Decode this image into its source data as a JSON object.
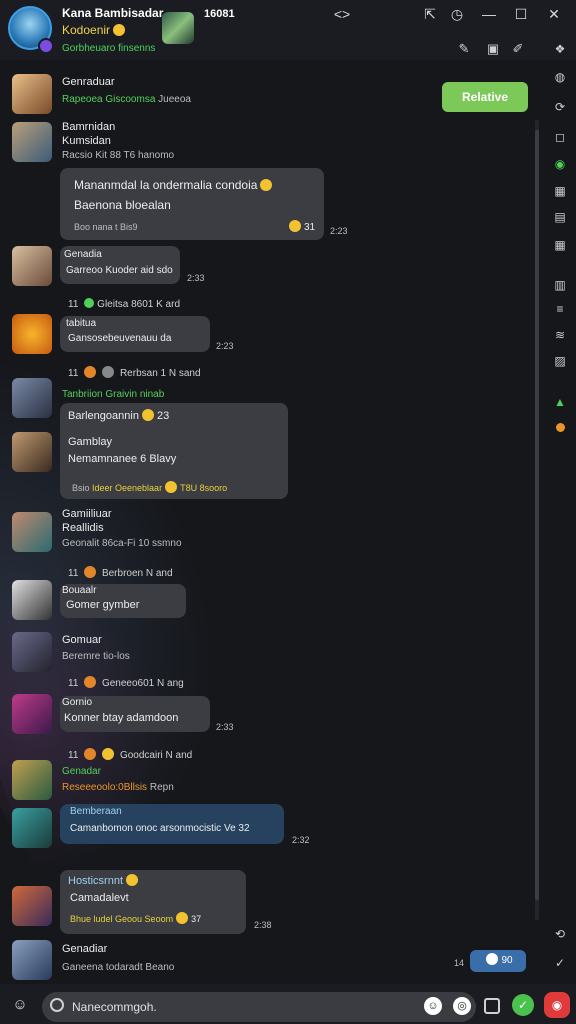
{
  "header": {
    "title": "Kana Bambisadar",
    "status": "Kodoenir",
    "subtitle": "Gorbheuaro finsenns",
    "counter": "16081"
  },
  "colors": {
    "accent_green": "#7cc95a",
    "name_green": "#4cd15a",
    "name_orange": "#e8962a",
    "name_yellow": "#e8d23a",
    "bubble": "#3b3d43",
    "bubble_highlight": "#27425e"
  },
  "icons": {
    "window": [
      "code-icon",
      "pin-icon",
      "minimize-icon",
      "maximize-icon",
      "close-icon"
    ],
    "toolbar": [
      "pen-icon",
      "copy-icon",
      "edit-icon"
    ],
    "rail": [
      "gift-icon",
      "wifi-icon",
      "check-circle-icon",
      "sticker-icon",
      "image-icon",
      "image-icon",
      "chart-icon",
      "list-icon",
      "voice-icon",
      "photo-icon",
      "upload-icon",
      "status-dot-icon",
      "timer-icon",
      "check-icon"
    ]
  },
  "relative_button": "Relative",
  "messages": [
    {
      "name": "Genraduar",
      "meta": "Rapeoea Giscoomsa",
      "meta2": "Jueeoa"
    },
    {
      "name": "Bamrnidan\nKumsidan",
      "meta": "Racsio Kit 88 T6 hanomo",
      "bubble1": "Mananmdal la ondermalia condoia",
      "bubble2": "Baenona bloealan",
      "bubble_meta": "Boo nana t Bis9",
      "bubble_count": "31",
      "time": "2:23"
    },
    {
      "name": "Genadia",
      "meta": "Garreoo Kuoder aid sdo",
      "time": "2:33"
    },
    {
      "system": "Gleitsa 8601 K ard"
    },
    {
      "name": "tabitua",
      "bubble": "Gansosebeuvenauu da",
      "time": "2:23"
    },
    {
      "system": "Rerbsan 1 N sand"
    },
    {
      "name": "Tanbriion Graivin ninab",
      "bubble1": "Barlengoannin",
      "bubble1_count": "23",
      "bubble2": "Gamblay",
      "bubble3": "Nemamnanee 6 Blavy",
      "bubble_meta": "Ideer Oeeneblaar",
      "bubble_meta2": "T8U 8sooro"
    },
    {
      "name": "Gamiiliuar\nReallidis",
      "meta": "Geonalit 86ca-Fi 10 ssmno"
    },
    {
      "system": "Berbroen N and"
    },
    {
      "name": "Bouaalr",
      "bubble": "Gomer gymber"
    },
    {
      "name": "Gomuar",
      "meta": "Beremre tio-los"
    },
    {
      "system": "Geneeo601 N ang"
    },
    {
      "name": "Gornio",
      "bubble": "Konner btay adamdoon",
      "time": "2:33"
    },
    {
      "system": "Goodcairi N and"
    },
    {
      "name": "Genadar",
      "meta": "Reseeeoolo:0Bllsis",
      "meta2": "Repn"
    },
    {
      "name": "Bemberaan",
      "bubble": "Camanbomon onoc arsonmocistic Ve 32",
      "time": "2:32"
    },
    {
      "name": "Hosticsrnnt",
      "bubble2": "Camadalevt",
      "bubble_meta": "Bhue ludel Geoou Seoom",
      "bubble_count": "37",
      "time": "2:38"
    },
    {
      "name": "Genadiar",
      "meta": "Ganeena todaradt",
      "meta2": "Beano"
    }
  ],
  "unread_pill": {
    "count_left": "14",
    "count_right": "90"
  },
  "composer": {
    "placeholder": "Nanecommgoh."
  }
}
